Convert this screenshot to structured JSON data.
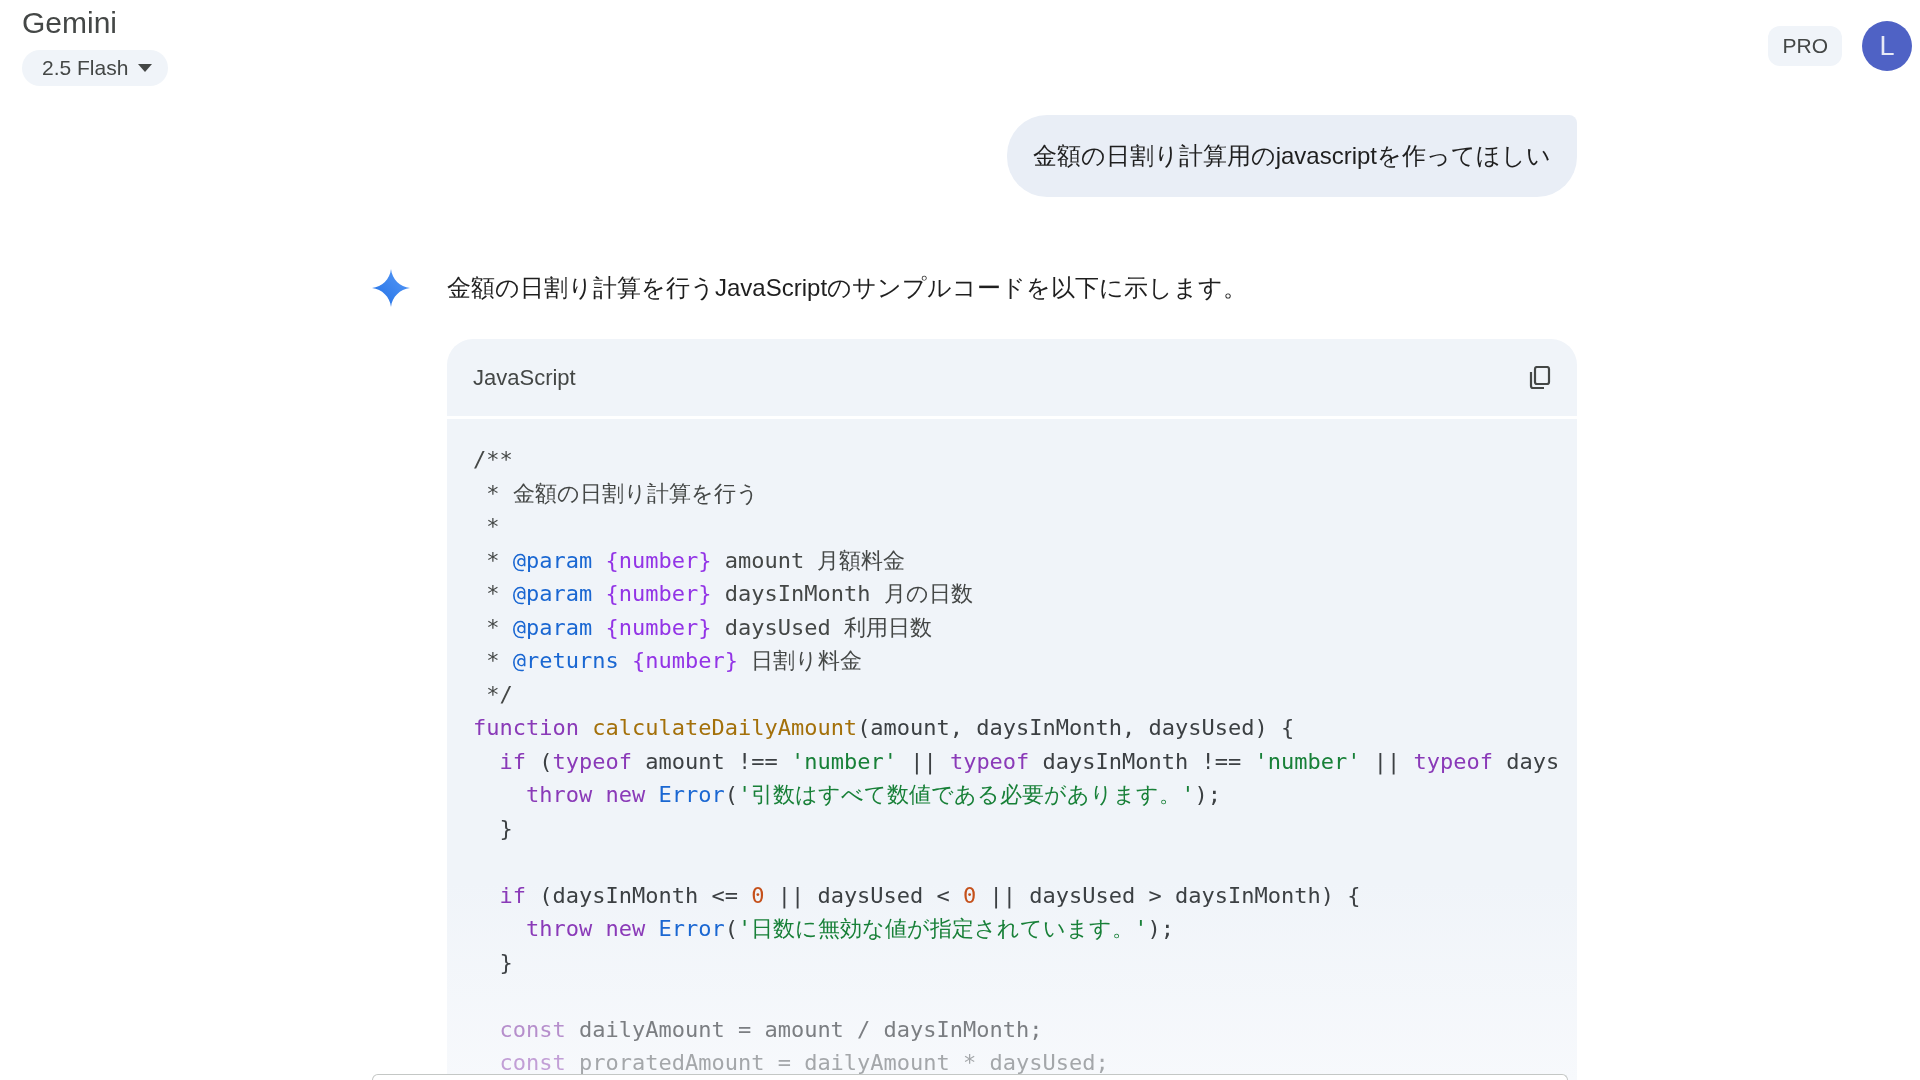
{
  "app": {
    "title": "Gemini",
    "model_selector": "2.5 Flash",
    "plan_badge": "PRO",
    "avatar_initial": "L"
  },
  "conversation": [
    {
      "kind": "user",
      "text": "金額の日割り計算用のjavascriptを作ってほしい"
    },
    {
      "kind": "response",
      "text": "金額の日割り計算を行うJavaScriptのサンプルコードを以下に示します。",
      "code_block": {
        "language": "JavaScript",
        "lines": [
          {
            "kind": "code",
            "tokens": [
              {
                "text": "/**",
                "color": "#444746"
              }
            ]
          },
          {
            "kind": "code",
            "tokens": [
              {
                "text": " * 金額の日割り計算を行う",
                "color": "#444746"
              }
            ]
          },
          {
            "kind": "code",
            "tokens": [
              {
                "text": " *",
                "color": "#444746"
              }
            ]
          },
          {
            "kind": "code",
            "tokens": [
              {
                "text": " *",
                "color": "#444746"
              },
              {
                "text": " @param",
                "color": "#1a67d2"
              },
              {
                "text": " {number}",
                "color": "#9334e6"
              },
              {
                "text": " amount 月額料金",
                "color": "#444746"
              }
            ]
          },
          {
            "kind": "code",
            "tokens": [
              {
                "text": " *",
                "color": "#444746"
              },
              {
                "text": " @param",
                "color": "#1a67d2"
              },
              {
                "text": " {number}",
                "color": "#9334e6"
              },
              {
                "text": " daysInMonth 月の日数",
                "color": "#444746"
              }
            ]
          },
          {
            "kind": "code",
            "tokens": [
              {
                "text": " *",
                "color": "#444746"
              },
              {
                "text": " @param",
                "color": "#1a67d2"
              },
              {
                "text": " {number}",
                "color": "#9334e6"
              },
              {
                "text": " daysUsed 利用日数",
                "color": "#444746"
              }
            ]
          },
          {
            "kind": "code",
            "tokens": [
              {
                "text": " *",
                "color": "#444746"
              },
              {
                "text": " @returns",
                "color": "#1a67d2"
              },
              {
                "text": " {number}",
                "color": "#9334e6"
              },
              {
                "text": " 日割り料金",
                "color": "#444746"
              }
            ]
          },
          {
            "kind": "code",
            "tokens": [
              {
                "text": " */",
                "color": "#444746"
              }
            ]
          },
          {
            "kind": "code",
            "tokens": [
              {
                "text": "function",
                "color": "#8a3ab8"
              },
              {
                "text": " calculateDailyAmount",
                "color": "#a3700a"
              },
              {
                "text": "(amount, daysInMonth, daysUsed) {",
                "color": "#3c4043"
              }
            ]
          },
          {
            "kind": "code",
            "tokens": [
              {
                "text": "  if",
                "color": "#8a3ab8"
              },
              {
                "text": " (",
                "color": "#3c4043"
              },
              {
                "text": "typeof",
                "color": "#8a3ab8"
              },
              {
                "text": " amount !==",
                "color": "#3c4043"
              },
              {
                "text": " 'number'",
                "color": "#188038"
              },
              {
                "text": " ||",
                "color": "#3c4043"
              },
              {
                "text": " typeof",
                "color": "#8a3ab8"
              },
              {
                "text": " daysInMonth !==",
                "color": "#3c4043"
              },
              {
                "text": " 'number'",
                "color": "#188038"
              },
              {
                "text": " ||",
                "color": "#3c4043"
              },
              {
                "text": " typeof",
                "color": "#8a3ab8"
              },
              {
                "text": " days",
                "color": "#3c4043"
              }
            ]
          },
          {
            "kind": "code",
            "tokens": [
              {
                "text": "    throw new",
                "color": "#8a3ab8"
              },
              {
                "text": " Error",
                "color": "#1a67d2"
              },
              {
                "text": "(",
                "color": "#3c4043"
              },
              {
                "text": "'引数はすべて数値である必要があります。'",
                "color": "#188038"
              },
              {
                "text": ");",
                "color": "#3c4043"
              }
            ]
          },
          {
            "kind": "code",
            "tokens": [
              {
                "text": "  }",
                "color": "#3c4043"
              }
            ]
          },
          {
            "kind": "blank"
          },
          {
            "kind": "code",
            "tokens": [
              {
                "text": "  if",
                "color": "#8a3ab8"
              },
              {
                "text": " (daysInMonth <=",
                "color": "#3c4043"
              },
              {
                "text": " 0",
                "color": "#c5501a"
              },
              {
                "text": " || daysUsed <",
                "color": "#3c4043"
              },
              {
                "text": " 0",
                "color": "#c5501a"
              },
              {
                "text": " || daysUsed > daysInMonth) {",
                "color": "#3c4043"
              }
            ]
          },
          {
            "kind": "code",
            "tokens": [
              {
                "text": "    throw new",
                "color": "#8a3ab8"
              },
              {
                "text": " Error",
                "color": "#1a67d2"
              },
              {
                "text": "(",
                "color": "#3c4043"
              },
              {
                "text": "'日数に無効な値が指定されています。'",
                "color": "#188038"
              },
              {
                "text": ");",
                "color": "#3c4043"
              }
            ]
          },
          {
            "kind": "code",
            "tokens": [
              {
                "text": "  }",
                "color": "#3c4043"
              }
            ]
          },
          {
            "kind": "blank"
          },
          {
            "kind": "code",
            "tokens": [
              {
                "text": "  const",
                "color": "#b68fcc"
              },
              {
                "text": " dailyAmount = amount / daysInMonth;",
                "color": "#7b7e82"
              }
            ]
          },
          {
            "kind": "code",
            "tokens": [
              {
                "text": "  const",
                "color": "#c29fd6"
              },
              {
                "text": " proratedAmount = dailyAmount * daysUsed;",
                "color": "#a4a7aa"
              }
            ]
          }
        ]
      }
    }
  ]
}
